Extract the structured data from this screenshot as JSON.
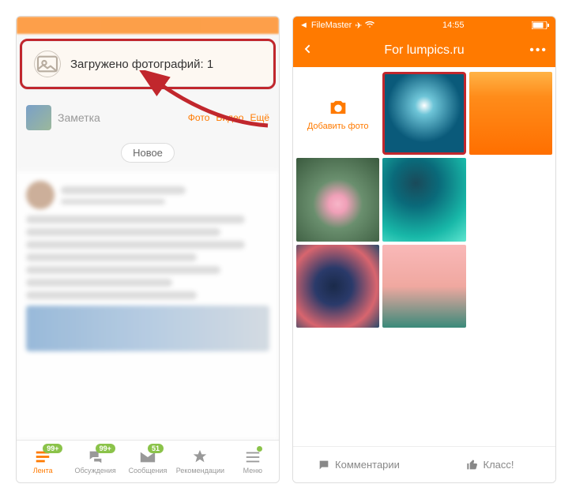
{
  "left": {
    "notification": {
      "text": "Загружено фотографий: 1"
    },
    "compose": {
      "placeholder": "Заметка",
      "actions": {
        "photo": "Фото",
        "video": "Видео",
        "more": "Ещё"
      }
    },
    "new_pill": "Новое",
    "tabs": {
      "feed": {
        "label": "Лента",
        "badge": "99+"
      },
      "discussions": {
        "label": "Обсуждения",
        "badge": "99+"
      },
      "messages": {
        "label": "Сообщения",
        "badge": "51"
      },
      "recs": {
        "label": "Рекомендации"
      },
      "menu": {
        "label": "Меню"
      }
    }
  },
  "right": {
    "status": {
      "back_app": "FileMaster",
      "time": "14:55"
    },
    "nav": {
      "title": "For lumpics.ru"
    },
    "add_photo_label": "Добавить фото",
    "footer": {
      "comments": "Комментарии",
      "klass": "Класс!"
    }
  }
}
